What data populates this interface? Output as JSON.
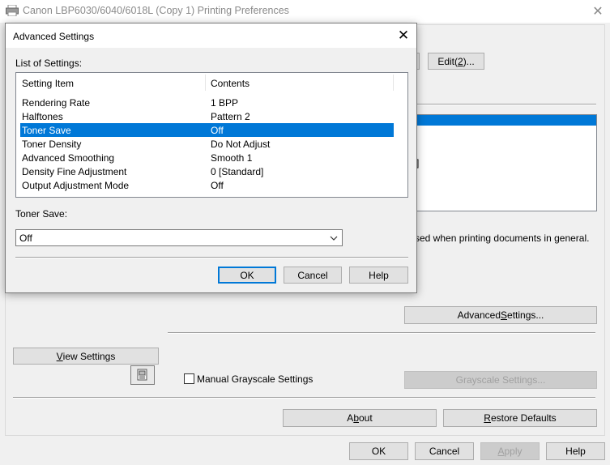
{
  "parent_window": {
    "title": "Canon LBP6030/6040/6018L (Copy 1) Printing Preferences",
    "close_glyph": "✕"
  },
  "parent_content": {
    "edit_button": {
      "prefix": "Edit(",
      "accel": "2",
      "suffix": ")..."
    },
    "list_fragment_text": "]",
    "used_text": "sed when printing documents in general.",
    "advanced_settings_button": {
      "prefix": "Advanced ",
      "accel": "S",
      "suffix": "ettings..."
    },
    "view_settings_button": {
      "accel": "V",
      "suffix": "iew Settings"
    },
    "manual_grayscale_label": "Manual Grayscale Settings",
    "manual_grayscale_checked": false,
    "grayscale_settings_button": "Grayscale Settings...",
    "about_button": {
      "prefix": "A",
      "accel": "b",
      "suffix": "out"
    },
    "restore_defaults_button": {
      "accel": "R",
      "suffix": "estore Defaults"
    }
  },
  "bottom_buttons": {
    "ok": "OK",
    "cancel": "Cancel",
    "apply": {
      "accel": "A",
      "suffix": "pply"
    },
    "help": "Help"
  },
  "dialog": {
    "title": "Advanced Settings",
    "close_glyph": "✕",
    "list_label": "List of Settings:",
    "columns": [
      "Setting Item",
      "Contents"
    ],
    "rows": [
      {
        "item": "Rendering Rate",
        "content": "1 BPP"
      },
      {
        "item": "Halftones",
        "content": "Pattern 2"
      },
      {
        "item": "Toner Save",
        "content": "Off"
      },
      {
        "item": "Toner Density",
        "content": "Do Not Adjust"
      },
      {
        "item": "Advanced Smoothing",
        "content": "Smooth 1"
      },
      {
        "item": "Density Fine Adjustment",
        "content": "0 [Standard]"
      },
      {
        "item": "Output Adjustment Mode",
        "content": "Off"
      }
    ],
    "selected_row": "Toner Save",
    "toner_save_label": "Toner Save:",
    "toner_save_value": "Off",
    "ok": "OK",
    "cancel": "Cancel",
    "help": "Help"
  },
  "colors": {
    "selection": "#0078d7",
    "window_bg": "#f0f0f0",
    "button_bg": "#e1e1e1"
  },
  "icons": [
    "printer-icon",
    "close-icon",
    "chevron-down-icon",
    "view-settings-icon"
  ]
}
